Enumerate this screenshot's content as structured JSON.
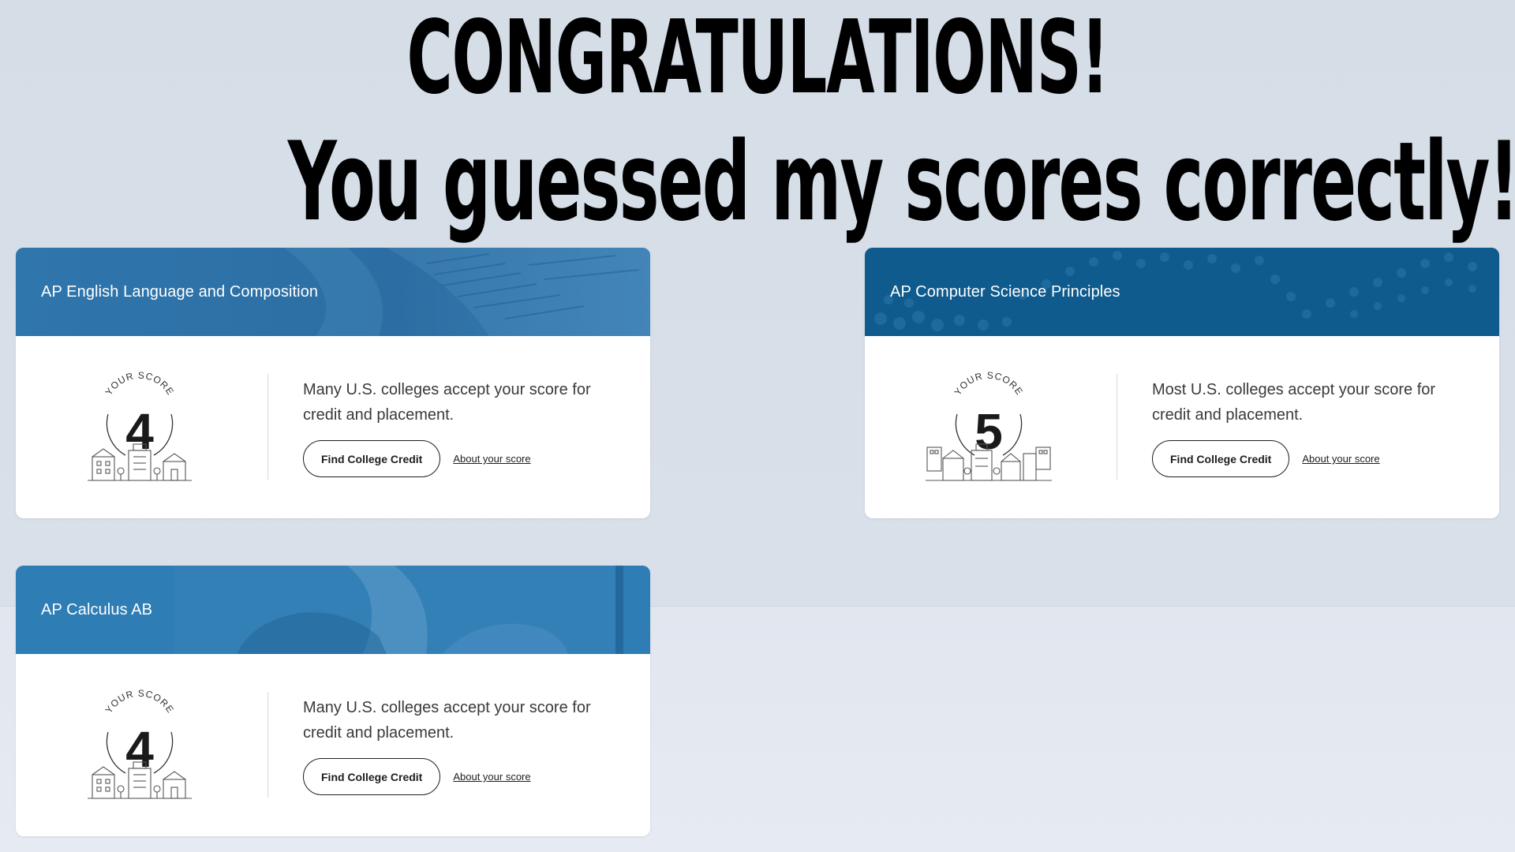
{
  "headline": {
    "line1": "CONGRATULATIONS!",
    "line2": "You guessed my scores correctly!"
  },
  "score_label": "YOUR SCORE",
  "colors": {
    "header_blue": "#2f7db5",
    "header_blue_dark": "#0f5a8c",
    "text": "#3a3a3a"
  },
  "cards": [
    {
      "title": "AP English Language and Composition",
      "score": "4",
      "message": "Many U.S. colleges accept your score for credit and placement.",
      "button_label": "Find College Credit",
      "link_label": "About your score"
    },
    {
      "title": "AP Computer Science Principles",
      "score": "5",
      "message": "Most U.S. colleges accept your score for credit and placement.",
      "button_label": "Find College Credit",
      "link_label": "About your score"
    },
    {
      "title": "AP Calculus AB",
      "score": "4",
      "message": "Many U.S. colleges accept your score for credit and placement.",
      "button_label": "Find College Credit",
      "link_label": "About your score"
    }
  ]
}
